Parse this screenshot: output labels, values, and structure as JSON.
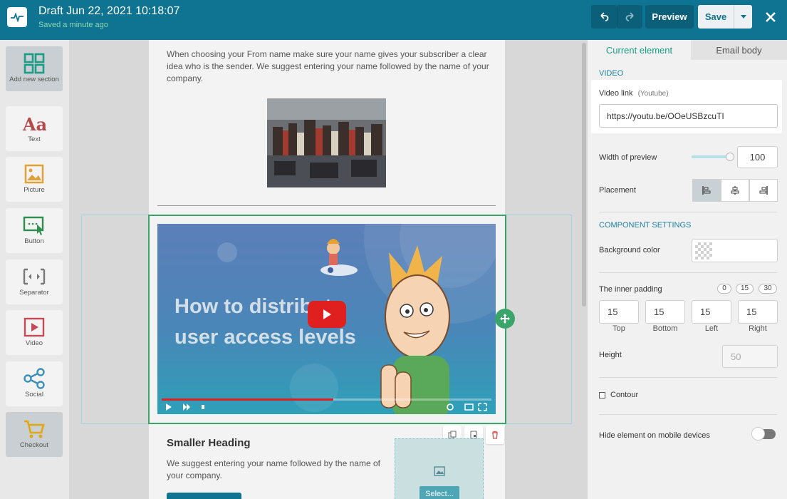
{
  "header": {
    "title": "Draft Jun 22, 2021 10:18:07",
    "saved_status": "Saved a minute ago",
    "preview_label": "Preview",
    "save_label": "Save",
    "brand_color": "#0f7491"
  },
  "sidebar": {
    "items": [
      {
        "label": "Add new section",
        "icon": "grid-icon"
      },
      {
        "label": "Text",
        "icon": "text-aa-icon"
      },
      {
        "label": "Picture",
        "icon": "picture-icon"
      },
      {
        "label": "Button",
        "icon": "button-cursor-icon"
      },
      {
        "label": "Separator",
        "icon": "separator-icon"
      },
      {
        "label": "Video",
        "icon": "video-icon"
      },
      {
        "label": "Social",
        "icon": "share-icon"
      },
      {
        "label": "Checkout",
        "icon": "cart-icon"
      }
    ]
  },
  "canvas": {
    "intro_text": "When choosing your From name make sure your name gives your subscriber a clear idea who is the sender. We suggest entering your name followed by the name of your company.",
    "video_title_line1": "How to distribute",
    "video_title_line2": "user access levels",
    "video_progress": 0.52,
    "smaller_heading": "Smaller Heading",
    "smaller_text": "We suggest entering your name followed by the name of your company.",
    "select_label": "Select..."
  },
  "panel": {
    "tabs": [
      "Current element",
      "Email body"
    ],
    "video_section_title": "VIDEO",
    "video_link_label": "Video link",
    "video_link_hint": "(Youtube)",
    "video_link_value": "https://youtu.be/OOeUSBzcuTI",
    "width_label": "Width of preview",
    "width_value": "100",
    "placement_label": "Placement",
    "component_title": "COMPONENT SETTINGS",
    "bg_color_label": "Background color",
    "inner_padding_label": "The inner padding",
    "padding_presets": [
      "0",
      "15",
      "30"
    ],
    "padding": {
      "top": "15",
      "bottom": "15",
      "left": "15",
      "right": "15"
    },
    "padding_labels": {
      "top": "Top",
      "bottom": "Bottom",
      "left": "Left",
      "right": "Right"
    },
    "height_label": "Height",
    "height_placeholder": "50",
    "contour_label": "Contour",
    "hide_mobile_label": "Hide element on mobile devices"
  }
}
